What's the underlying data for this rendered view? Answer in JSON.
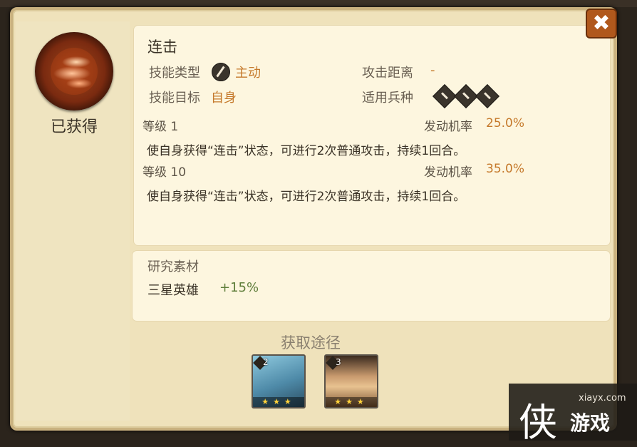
{
  "dialog": {
    "obtained_label": "已获得",
    "close_label": "✖",
    "skill": {
      "name": "连击",
      "type_label": "技能类型",
      "type_value": "主动",
      "range_label": "攻击距离",
      "range_value": "-",
      "target_label": "技能目标",
      "target_value": "自身",
      "troop_label": "适用兵种",
      "troop_icons": [
        "sword-icon",
        "cavalry-icon",
        "bow-icon"
      ]
    },
    "levels": [
      {
        "level_text": "等级 1",
        "rate_label": "发动机率",
        "rate_value": "25.0%",
        "desc": "使自身获得“连击”状态，可进行2次普通攻击，持续1回合。"
      },
      {
        "level_text": "等级 10",
        "rate_label": "发动机率",
        "rate_value": "35.0%",
        "desc": "使自身获得“连击”状态，可进行2次普通攻击，持续1回合。"
      }
    ],
    "research": {
      "title": "研究素材",
      "item": "三星英雄",
      "bonus": "+15%"
    },
    "obtain": {
      "title": "获取途径",
      "heroes": [
        {
          "icon": "shark-hero-portrait",
          "number": "2",
          "stars": "★★★"
        },
        {
          "icon": "elf-hero-portrait",
          "number": "3",
          "stars": "★★★"
        }
      ]
    }
  },
  "watermark": {
    "url": "xiayx.com",
    "logo": "侠",
    "name": "游戏"
  },
  "colors": {
    "accent_orange": "#c5792b",
    "bonus_green": "#5e7d3a",
    "panel_bg": "#efe2bb"
  }
}
